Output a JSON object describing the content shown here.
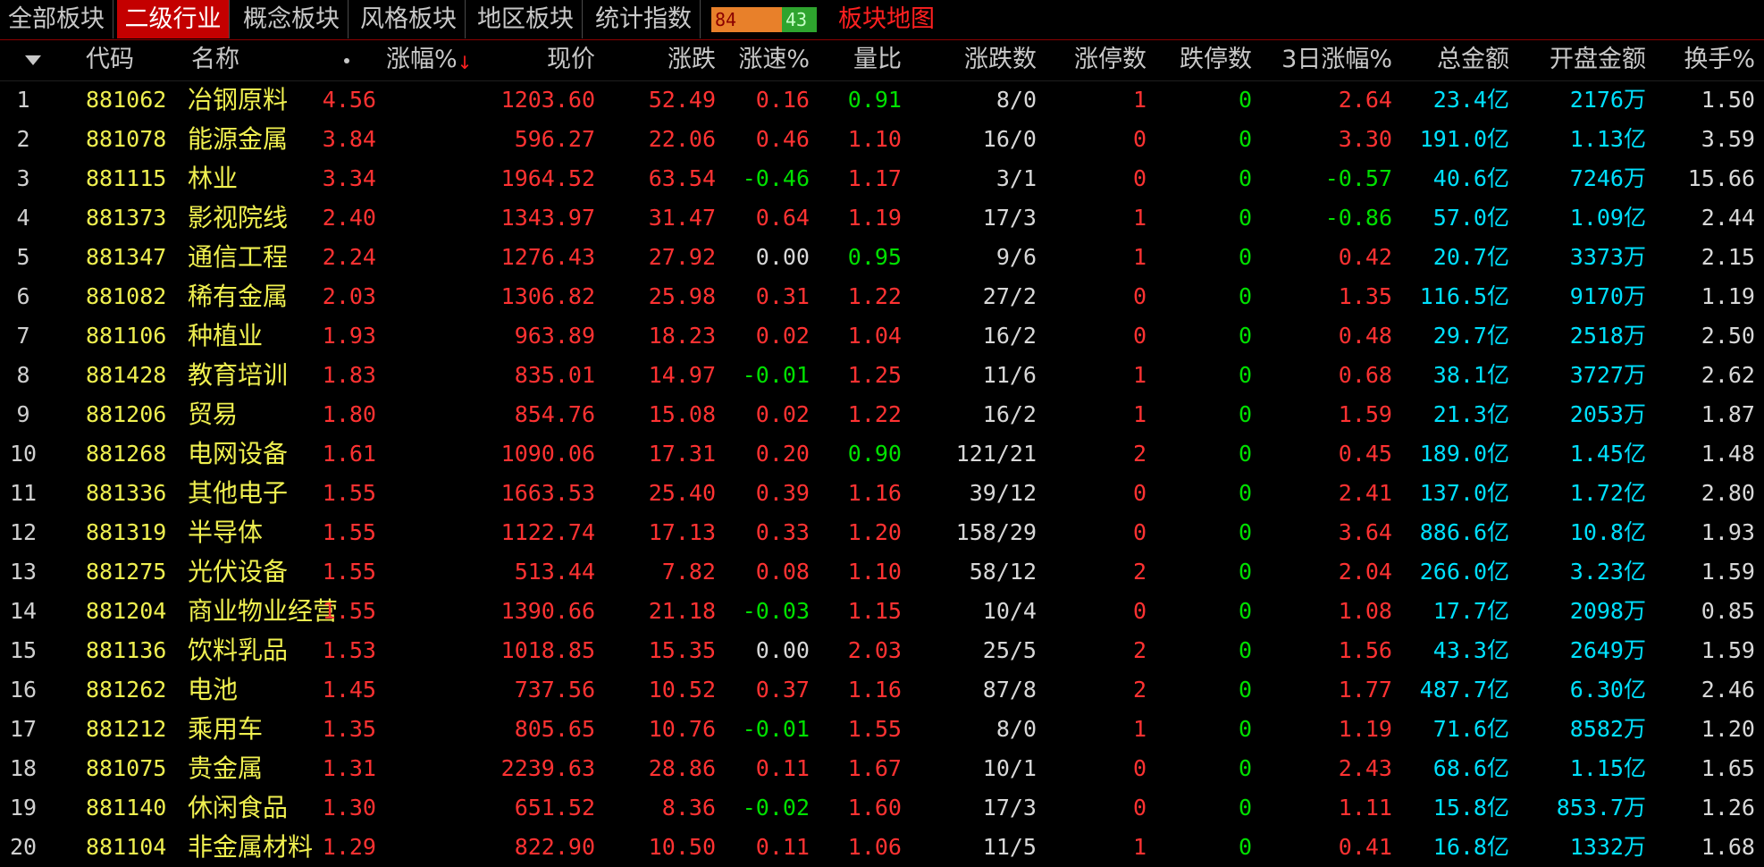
{
  "tabs": [
    {
      "label": "全部板块",
      "active": false
    },
    {
      "label": "二级行业",
      "active": true
    },
    {
      "label": "概念板块",
      "active": false
    },
    {
      "label": "风格板块",
      "active": false
    },
    {
      "label": "地区板块",
      "active": false
    },
    {
      "label": "统计指数",
      "active": false
    }
  ],
  "indicator": {
    "up": "84",
    "down": "43"
  },
  "map_link": "板块地图",
  "columns": {
    "code": "代码",
    "name": "名称",
    "pct": "涨幅%",
    "price": "现价",
    "chg": "涨跌",
    "speed": "涨速%",
    "vol_ratio": "量比",
    "updown": "涨跌数",
    "limit_up": "涨停数",
    "limit_down": "跌停数",
    "pct3d": "3日涨幅%",
    "amount": "总金额",
    "open_amount": "开盘金额",
    "turnover": "换手%"
  },
  "colors": {
    "up": "#ff3232",
    "down": "#00e000",
    "flat": "#d8d8d8",
    "code": "#f0f050",
    "amount": "#00e0ff",
    "active_tab": "#c40000"
  },
  "rows": [
    [
      "1",
      "881062",
      "冶钢原料",
      "4.56",
      "1203.60",
      "52.49",
      "0.16",
      "0.91",
      "8/0",
      "1",
      "0",
      "2.64",
      "23.4亿",
      "2176万",
      "1.50"
    ],
    [
      "2",
      "881078",
      "能源金属",
      "3.84",
      "596.27",
      "22.06",
      "0.46",
      "1.10",
      "16/0",
      "0",
      "0",
      "3.30",
      "191.0亿",
      "1.13亿",
      "3.59"
    ],
    [
      "3",
      "881115",
      "林业",
      "3.34",
      "1964.52",
      "63.54",
      "-0.46",
      "1.17",
      "3/1",
      "0",
      "0",
      "-0.57",
      "40.6亿",
      "7246万",
      "15.66"
    ],
    [
      "4",
      "881373",
      "影视院线",
      "2.40",
      "1343.97",
      "31.47",
      "0.64",
      "1.19",
      "17/3",
      "1",
      "0",
      "-0.86",
      "57.0亿",
      "1.09亿",
      "2.44"
    ],
    [
      "5",
      "881347",
      "通信工程",
      "2.24",
      "1276.43",
      "27.92",
      "0.00",
      "0.95",
      "9/6",
      "1",
      "0",
      "0.42",
      "20.7亿",
      "3373万",
      "2.15"
    ],
    [
      "6",
      "881082",
      "稀有金属",
      "2.03",
      "1306.82",
      "25.98",
      "0.31",
      "1.22",
      "27/2",
      "0",
      "0",
      "1.35",
      "116.5亿",
      "9170万",
      "1.19"
    ],
    [
      "7",
      "881106",
      "种植业",
      "1.93",
      "963.89",
      "18.23",
      "0.02",
      "1.04",
      "16/2",
      "0",
      "0",
      "0.48",
      "29.7亿",
      "2518万",
      "2.50"
    ],
    [
      "8",
      "881428",
      "教育培训",
      "1.83",
      "835.01",
      "14.97",
      "-0.01",
      "1.25",
      "11/6",
      "1",
      "0",
      "0.68",
      "38.1亿",
      "3727万",
      "2.62"
    ],
    [
      "9",
      "881206",
      "贸易",
      "1.80",
      "854.76",
      "15.08",
      "0.02",
      "1.22",
      "16/2",
      "1",
      "0",
      "1.59",
      "21.3亿",
      "2053万",
      "1.87"
    ],
    [
      "10",
      "881268",
      "电网设备",
      "1.61",
      "1090.06",
      "17.31",
      "0.20",
      "0.90",
      "121/21",
      "2",
      "0",
      "0.45",
      "189.0亿",
      "1.45亿",
      "1.48"
    ],
    [
      "11",
      "881336",
      "其他电子",
      "1.55",
      "1663.53",
      "25.40",
      "0.39",
      "1.16",
      "39/12",
      "0",
      "0",
      "2.41",
      "137.0亿",
      "1.72亿",
      "2.80"
    ],
    [
      "12",
      "881319",
      "半导体",
      "1.55",
      "1122.74",
      "17.13",
      "0.33",
      "1.20",
      "158/29",
      "0",
      "0",
      "3.64",
      "886.6亿",
      "10.8亿",
      "1.93"
    ],
    [
      "13",
      "881275",
      "光伏设备",
      "1.55",
      "513.44",
      "7.82",
      "0.08",
      "1.10",
      "58/12",
      "2",
      "0",
      "2.04",
      "266.0亿",
      "3.23亿",
      "1.59"
    ],
    [
      "14",
      "881204",
      "商业物业经营",
      "1.55",
      "1390.66",
      "21.18",
      "-0.03",
      "1.15",
      "10/4",
      "0",
      "0",
      "1.08",
      "17.7亿",
      "2098万",
      "0.85"
    ],
    [
      "15",
      "881136",
      "饮料乳品",
      "1.53",
      "1018.85",
      "15.35",
      "0.00",
      "2.03",
      "25/5",
      "2",
      "0",
      "1.56",
      "43.3亿",
      "2649万",
      "1.59"
    ],
    [
      "16",
      "881262",
      "电池",
      "1.45",
      "737.56",
      "10.52",
      "0.37",
      "1.16",
      "87/8",
      "2",
      "0",
      "1.77",
      "487.7亿",
      "6.30亿",
      "2.46"
    ],
    [
      "17",
      "881212",
      "乘用车",
      "1.35",
      "805.65",
      "10.76",
      "-0.01",
      "1.55",
      "8/0",
      "1",
      "0",
      "1.19",
      "71.6亿",
      "8582万",
      "1.20"
    ],
    [
      "18",
      "881075",
      "贵金属",
      "1.31",
      "2239.63",
      "28.86",
      "0.11",
      "1.67",
      "10/1",
      "0",
      "0",
      "2.43",
      "68.6亿",
      "1.15亿",
      "1.65"
    ],
    [
      "19",
      "881140",
      "休闲食品",
      "1.30",
      "651.52",
      "8.36",
      "-0.02",
      "1.60",
      "17/3",
      "0",
      "0",
      "1.11",
      "15.8亿",
      "853.7万",
      "1.26"
    ],
    [
      "20",
      "881104",
      "非金属材料",
      "1.29",
      "822.90",
      "10.50",
      "0.11",
      "1.06",
      "11/5",
      "1",
      "0",
      "0.41",
      "16.8亿",
      "1332万",
      "1.68"
    ]
  ]
}
